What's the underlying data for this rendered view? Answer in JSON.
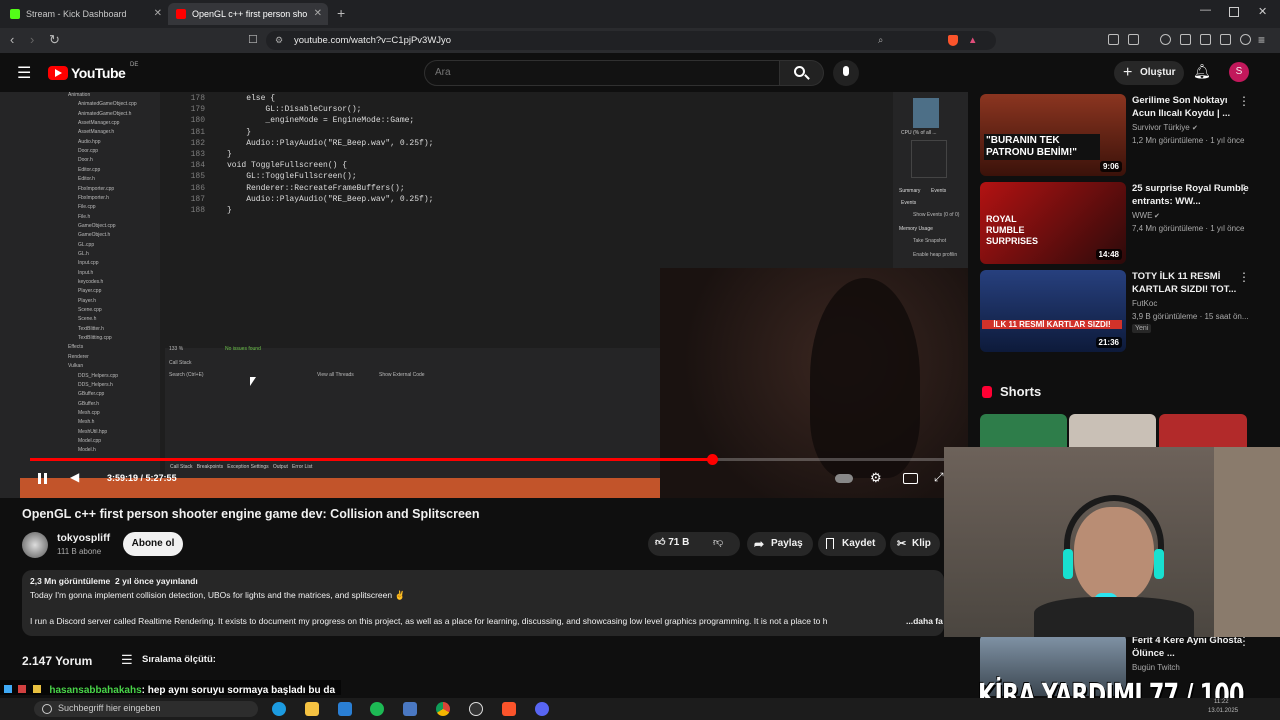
{
  "browser": {
    "tabs": [
      {
        "label": "Stream - Kick Dashboard",
        "favicon_color": "#53fc18"
      },
      {
        "label": "OpenGL c++ first person sho",
        "favicon_color": "#ff0000"
      }
    ],
    "new_tab_label": "+",
    "url": "youtube.com/watch?v=C1pjPv3WJyo"
  },
  "youtube": {
    "logo_text": "YouTube",
    "region": "DE",
    "search_placeholder": "Ara",
    "create_label": "Oluştur",
    "avatar_letter": "S",
    "accent": "#ff0000"
  },
  "video": {
    "code_lines": [
      {
        "n": "178",
        "text": "    else {"
      },
      {
        "n": "179",
        "text": "        GL::DisableCursor();"
      },
      {
        "n": "180",
        "text": "        _engineMode = EngineMode::Game;"
      },
      {
        "n": "181",
        "text": "    }"
      },
      {
        "n": "182",
        "text": "    Audio::PlayAudio(\"RE_Beep.wav\", 0.25f);"
      },
      {
        "n": "183",
        "text": "}"
      },
      {
        "n": "184",
        "text": "void ToggleFullscreen() {"
      },
      {
        "n": "185",
        "text": "    GL::ToggleFullscreen();"
      },
      {
        "n": "186",
        "text": "    Renderer::RecreateFrameBuffers();"
      },
      {
        "n": "187",
        "text": "    Audio::PlayAudio(\"RE_Beep.wav\", 0.25f);"
      },
      {
        "n": "188",
        "text": "}"
      }
    ],
    "tree_items": [
      "Animation",
      "AnimatedGameObject.cpp",
      "AnimatedGameObject.h",
      "AssetManager.cpp",
      "AssetManager.h",
      "Audio.hpp",
      "Door.cpp",
      "Door.h",
      "Editor.cpp",
      "Editor.h",
      "FbxImporter.cpp",
      "FbxImporter.h",
      "File.cpp",
      "File.h",
      "GameObject.cpp",
      "GameObject.h",
      "GL.cpp",
      "GL.h",
      "Input.cpp",
      "Input.h",
      "keycodes.h",
      "Player.cpp",
      "Player.h",
      "Scene.cpp",
      "Scene.h",
      "TextBlitter.h",
      "TextBlitting.cpp",
      "Effects",
      "Renderer",
      "Vulkan",
      "DDS_Helpers.cpp",
      "DDS_Helpers.h",
      "GBuffer.cpp",
      "GBuffer.h",
      "Mesh.cpp",
      "Mesh.h",
      "MeshUtil.hpp",
      "Model.cpp",
      "Model.h"
    ],
    "callstack_title": "Call Stack",
    "callstack_search": "Search (Ctrl+E)",
    "view_threads": "View all Threads",
    "show_external": "Show External Code",
    "zoom": "133 %",
    "no_issues": "No issues found",
    "bottom_tabs": [
      "Call Stack",
      "Breakpoints",
      "Exception Settings",
      "Output",
      "Error List"
    ],
    "diag_tabs": [
      "Summary",
      "Events"
    ],
    "diag_items": [
      "Events",
      "Show Events (0 of 0)",
      "Memory Usage",
      "Take Snapshot",
      "Enable heap profilin"
    ],
    "cpu_label": "CPU (% of all ...",
    "time_current": "3:59:19",
    "time_total": "5:27:55",
    "progress": 0.745
  },
  "details": {
    "title": "OpenGL c++ first person shooter engine game dev: Collision and Splitscreen",
    "channel": "tokyospliff",
    "subscribers": "111 B abone",
    "subscribe_label": "Abone ol",
    "likes": "71 B",
    "share_label": "Paylaş",
    "save_label": "Kaydet",
    "clip_label": "Klip",
    "views": "2,3 Mn görüntüleme",
    "published": "2 yıl önce yayınlandı",
    "desc_line1": "Today I'm gonna implement collision detection, UBOs for lights and the matrices, and splitscreen ✌",
    "desc_line2": "I run a Discord server called Realtime Rendering. It exists to document my progress on this project, as well as a place for learning, discussing, and showcasing low level graphics programming. It is not a place to h",
    "desc_more": "...daha fa",
    "comments_count": "2.147 Yorum",
    "sort_label": "Sıralama ölçütü:"
  },
  "sidebar": {
    "videos": [
      {
        "title": "Gerilime Son Noktayı Acun Ilıcalı Koydu | ...",
        "channel": "Survivor Türkiye",
        "meta": "1,2 Mn görüntüleme · 1 yıl önce",
        "duration": "9:06",
        "thumb_text": "\"BURANIN TEK PATRONU BENİM!\"",
        "thumb_color": "#6a1e12"
      },
      {
        "title": "25 surprise Royal Rumble entrants: WW...",
        "channel": "WWE",
        "meta": "7,4 Mn görüntüleme · 1 yıl önce",
        "duration": "14:48",
        "thumb_text": "ROYAL RUMBLE SURPRISES",
        "thumb_color": "#8a1010"
      },
      {
        "title": "TOTY İLK 11 RESMİ KARTLAR SIZDI! TOT...",
        "channel": "FutKoc",
        "meta": "3,9 B görüntüleme · 15 saat ön...",
        "badge": "Yeni",
        "duration": "21:36",
        "thumb_text": "İLK 11 RESMİ KARTLAR SIZDI!",
        "thumb_color": "#1b2f6a"
      },
      {
        "title": "Ferit 4 Kere Aynı Ghosta Ölünce ...",
        "channel": "Bugün Twitch",
        "meta": "",
        "duration": "",
        "thumb_text": "",
        "thumb_color": "#3a4048"
      }
    ],
    "shorts_label": "Shorts"
  },
  "overlay": {
    "chat_user": "hasansabbahakahs",
    "chat_text": ": hep aynı soruyu sormaya başladı bu da",
    "kira_text": "KİRA YARDIMI 77 / 100",
    "kira_current": 77,
    "kira_goal": 100,
    "chat_ghost": "Suchbegriff hier eingeben"
  },
  "taskbar": {
    "time": "11:22",
    "date": "13.01.2025"
  }
}
